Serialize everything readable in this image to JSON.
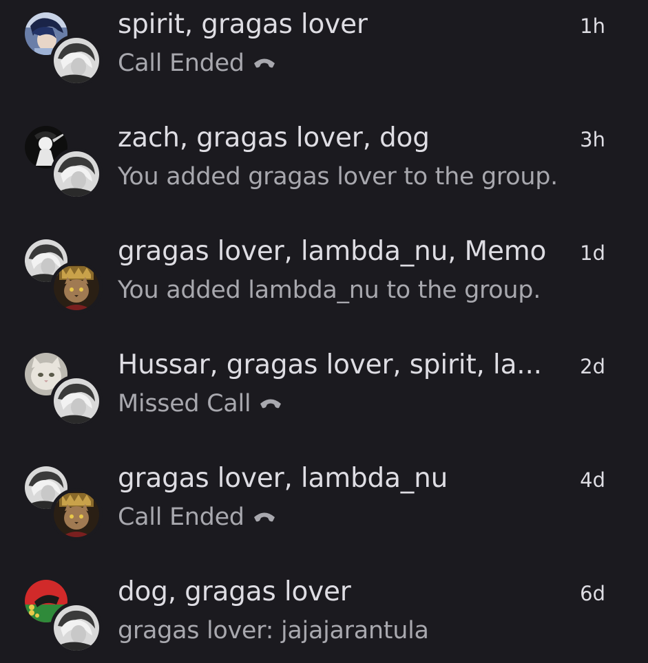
{
  "colors": {
    "background": "#1b1a1f",
    "title": "#dedde3",
    "subtitle": "#a8a8ae"
  },
  "conversations": [
    {
      "title": "spirit, gragas lover",
      "subtitle": "Call Ended",
      "subtitle_icon": "phone-hangup-icon",
      "time": "1h",
      "avatars": [
        "avatar-anime",
        "avatar-gragas-lover"
      ]
    },
    {
      "title": "zach, gragas lover, dog",
      "subtitle": "You added gragas lover to the group.",
      "subtitle_icon": null,
      "time": "3h",
      "avatars": [
        "avatar-manga",
        "avatar-gragas-lover"
      ]
    },
    {
      "title": "gragas lover, lambda_nu, Memo",
      "subtitle": "You added lambda_nu to the group.",
      "subtitle_icon": null,
      "time": "1d",
      "avatars": [
        "avatar-gragas-lover",
        "avatar-cat-king"
      ]
    },
    {
      "title": "Hussar, gragas lover, spirit, la...",
      "subtitle": "Missed Call",
      "subtitle_icon": "phone-hangup-icon",
      "time": "2d",
      "avatars": [
        "avatar-white-cat",
        "avatar-gragas-lover"
      ]
    },
    {
      "title": "gragas lover, lambda_nu",
      "subtitle": "Call Ended",
      "subtitle_icon": "phone-hangup-icon",
      "time": "4d",
      "avatars": [
        "avatar-gragas-lover",
        "avatar-cat-king"
      ]
    },
    {
      "title": "dog, gragas lover",
      "subtitle": "gragas lover: jajajarantula",
      "subtitle_icon": null,
      "time": "6d",
      "avatars": [
        "avatar-red-green",
        "avatar-gragas-lover"
      ]
    }
  ]
}
